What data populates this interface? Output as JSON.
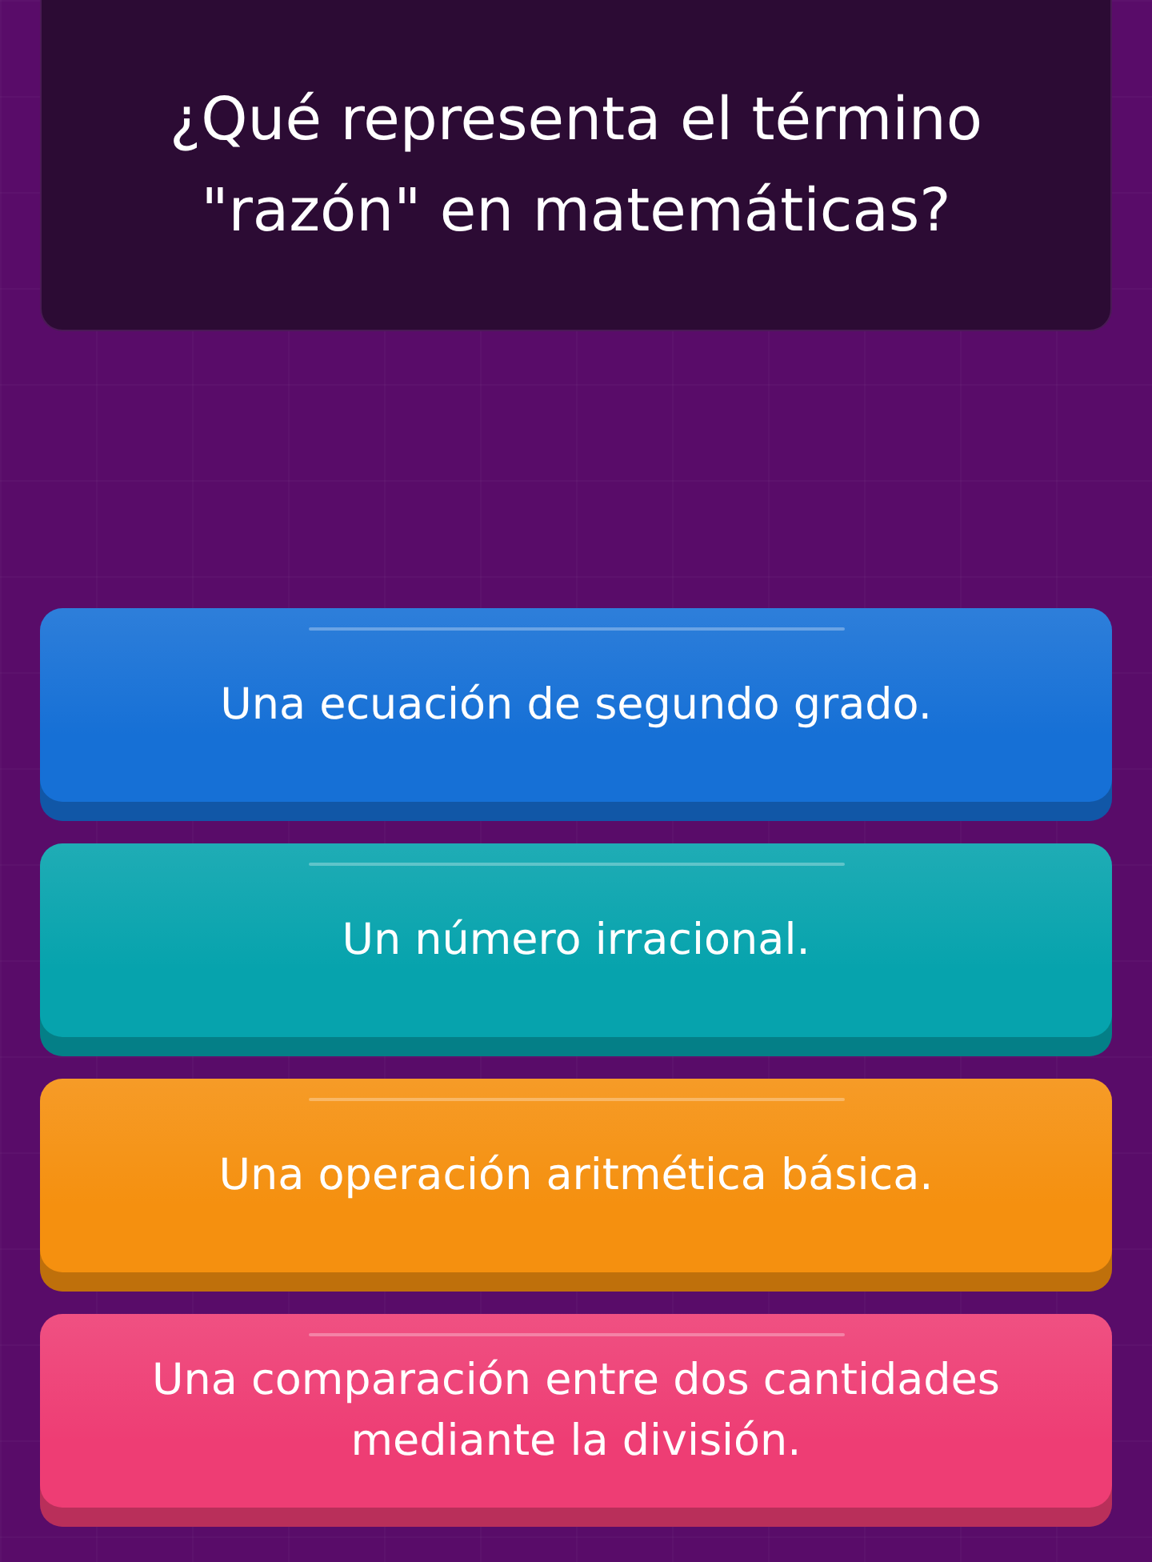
{
  "question": {
    "text": "¿Qué representa el término \"razón\" en matemáticas?"
  },
  "answers": [
    {
      "text": "Una ecuación de segundo grado.",
      "color": "#1670d6"
    },
    {
      "text": "Un número irracional.",
      "color": "#06a3ad"
    },
    {
      "text": "Una operación aritmética básica.",
      "color": "#f5900f"
    },
    {
      "text": "Una comparación entre dos cantidades mediante la división.",
      "color": "#ee3d74"
    }
  ]
}
